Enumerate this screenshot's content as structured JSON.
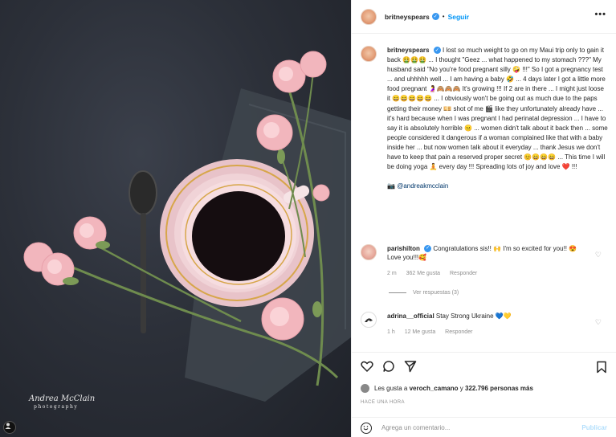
{
  "photo": {
    "watermark_name": "Andrea McClain",
    "watermark_sub": "photography"
  },
  "header": {
    "username": "britneyspears",
    "separator": "•",
    "follow_label": "Seguir",
    "more_label": "•••"
  },
  "caption": {
    "username": "britneyspears",
    "text": "I lost so much weight to go on my Maui trip only to gain it back 🤮🤮🤮 ... I thought \"Geez ... what happened to my stomach ???\" My husband said \"No you're food pregnant silly 🤪 !!!\" So I got a pregnancy test ... and uhhhhh well ... I am having a baby 🤣 ... 4 days later I got a little more food pregnant 🤰🙈🙈🙈 It's growing !!! If 2 are in there ... I might just loose it 😄😄😄😄😄 ... I obviously won't be going out as much due to the paps getting their money 💴 shot of me 🎬 like they unfortunately already have ... it's hard because when I was pregnant I had perinatal depression ... I have to say it is absolutely horrible 😐 ... women didn't talk about it back then ... some people considered it dangerous if a woman complained like that with a baby inside her ... but now women talk about it everyday ... thank Jesus we don't have to keep that pain a reserved proper secret 😊😄😄😄 ... This time I will be doing yoga 🧘 every day !!! Spreading lots of joy and love ❤️ !!!",
    "credit_icon": "📷",
    "credit": "@andreakmcclain"
  },
  "comments": [
    {
      "username": "parishilton",
      "text": "Congratulations sis!! 🙌 I'm so excited for you!! 😍 Love you!!!🥰",
      "time": "2 m",
      "likes": "362 Me gusta",
      "reply": "Responder"
    },
    {
      "username": "adrina__official",
      "text": "Stay Strong Ukraine 💙💛",
      "time": "1 h",
      "likes": "12 Me gusta",
      "reply": "Responder"
    }
  ],
  "view_replies": "Ver respuestas (3)",
  "likes_line": {
    "prefix": "Les gusta a",
    "user": "veroch_camano",
    "middle": "y",
    "count": "322.796 personas más"
  },
  "timestamp": "HACE UNA HORA",
  "add_comment": {
    "placeholder": "Agrega un comentario...",
    "post_label": "Publicar"
  }
}
